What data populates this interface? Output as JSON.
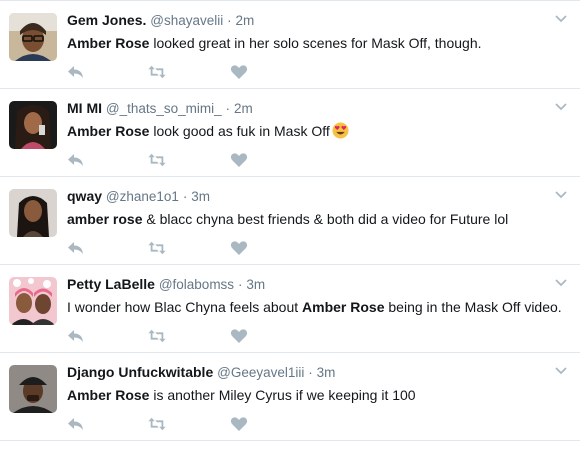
{
  "colors": {
    "text": "#14171a",
    "muted": "#657786",
    "icon": "#aab8c2",
    "divider": "#e1e8ed"
  },
  "tweets": [
    {
      "fullname": "Gem Jones.",
      "username": "@shayavelii",
      "separator": "·",
      "time": "2m",
      "text_bold": "Amber Rose",
      "text_rest": " looked great in her solo scenes for Mask Off, though.",
      "avatar": "avatar-woman-glasses",
      "actions": [
        "reply-icon",
        "retweet-icon",
        "like-icon"
      ]
    },
    {
      "fullname": "MI MI",
      "username": "@_thats_so_mimi_",
      "separator": "·",
      "time": "2m",
      "text_bold": "Amber Rose",
      "text_rest": " look good as fuk in Mask Off",
      "emoji": "heart-eyes-emoji",
      "avatar": "avatar-woman-selfie",
      "actions": [
        "reply-icon",
        "retweet-icon",
        "like-icon"
      ]
    },
    {
      "fullname": "qway",
      "username": "@zhane1o1",
      "separator": "·",
      "time": "3m",
      "text_bold": "amber rose",
      "text_rest": " & blacc chyna best friends & both did a video for Future lol",
      "avatar": "avatar-woman-long-hair",
      "actions": [
        "reply-icon",
        "retweet-icon",
        "like-icon"
      ]
    },
    {
      "fullname": "Petty LaBelle",
      "username": "@folabomss",
      "separator": "·",
      "time": "3m",
      "text_before": "I wonder how Blac Chyna feels about ",
      "text_bold": "Amber Rose",
      "text_after": " being in the Mask Off video.",
      "avatar": "avatar-group-filter",
      "actions": [
        "reply-icon",
        "retweet-icon",
        "like-icon"
      ]
    },
    {
      "fullname": "Django Unfuckwitable",
      "username": "@Geeyavel1iii",
      "separator": "·",
      "time": "3m",
      "text_bold": "Amber Rose",
      "text_rest": " is another Miley Cyrus if we keeping it 100",
      "avatar": "avatar-man-cap",
      "actions": [
        "reply-icon",
        "retweet-icon",
        "like-icon"
      ]
    }
  ]
}
